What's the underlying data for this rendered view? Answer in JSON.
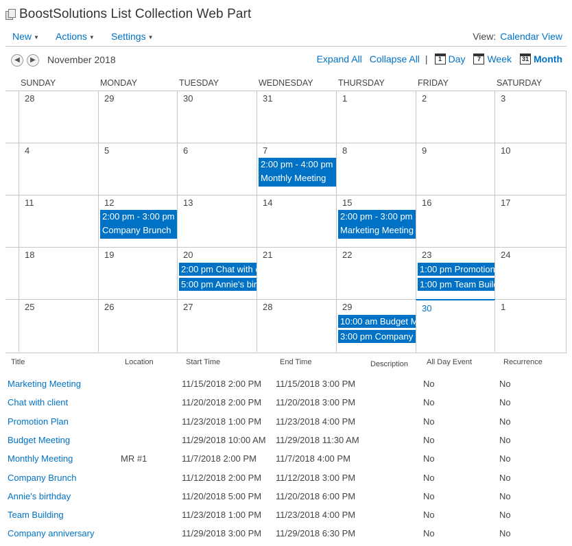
{
  "header": {
    "title": "BoostSolutions List Collection Web Part",
    "icon": "page-icon"
  },
  "menu": {
    "items": [
      {
        "label": "New"
      },
      {
        "label": "Actions"
      },
      {
        "label": "Settings"
      }
    ],
    "view_label": "View:",
    "view_value": "Calendar View"
  },
  "calendar": {
    "month_title": "November 2018",
    "expand_all": "Expand All",
    "collapse_all": "Collapse All",
    "separator": "|",
    "scopes": [
      {
        "label": "Day",
        "icon_text": "1"
      },
      {
        "label": "Week",
        "icon_text": "7"
      },
      {
        "label": "Month",
        "icon_text": "31"
      }
    ],
    "selected_scope": "Month",
    "days_of_week": [
      "SUNDAY",
      "MONDAY",
      "TUESDAY",
      "WEDNESDAY",
      "THURSDAY",
      "FRIDAY",
      "SATURDAY"
    ],
    "weeks": [
      {
        "days": [
          {
            "num": "28",
            "events": []
          },
          {
            "num": "29",
            "events": []
          },
          {
            "num": "30",
            "events": []
          },
          {
            "num": "31",
            "events": []
          },
          {
            "num": "1",
            "events": []
          },
          {
            "num": "2",
            "events": []
          },
          {
            "num": "3",
            "events": []
          }
        ]
      },
      {
        "days": [
          {
            "num": "4",
            "events": []
          },
          {
            "num": "5",
            "events": []
          },
          {
            "num": "6",
            "events": []
          },
          {
            "num": "7",
            "events": [
              {
                "time": "2:00 pm - 4:00 pm",
                "title": "Monthly Meeting"
              }
            ]
          },
          {
            "num": "8",
            "events": []
          },
          {
            "num": "9",
            "events": []
          },
          {
            "num": "10",
            "events": []
          }
        ]
      },
      {
        "days": [
          {
            "num": "11",
            "events": []
          },
          {
            "num": "12",
            "events": [
              {
                "time": "2:00 pm - 3:00 pm",
                "title": "Company Brunch"
              }
            ]
          },
          {
            "num": "13",
            "events": []
          },
          {
            "num": "14",
            "events": []
          },
          {
            "num": "15",
            "events": [
              {
                "time": "2:00 pm - 3:00 pm",
                "title": "Marketing Meeting"
              }
            ]
          },
          {
            "num": "16",
            "events": []
          },
          {
            "num": "17",
            "events": []
          }
        ]
      },
      {
        "days": [
          {
            "num": "18",
            "events": []
          },
          {
            "num": "19",
            "events": []
          },
          {
            "num": "20",
            "events": [
              {
                "text": "2:00 pm Chat with c"
              },
              {
                "text": "5:00 pm Annie's bir"
              }
            ]
          },
          {
            "num": "21",
            "events": []
          },
          {
            "num": "22",
            "events": []
          },
          {
            "num": "23",
            "events": [
              {
                "text": "1:00 pm Promotion"
              },
              {
                "text": "1:00 pm Team Build"
              }
            ]
          },
          {
            "num": "24",
            "events": []
          }
        ]
      },
      {
        "days": [
          {
            "num": "25",
            "events": []
          },
          {
            "num": "26",
            "events": []
          },
          {
            "num": "27",
            "events": []
          },
          {
            "num": "28",
            "events": []
          },
          {
            "num": "29",
            "events": [
              {
                "text": "10:00 am Budget M"
              },
              {
                "text": "3:00 pm Company a"
              }
            ]
          },
          {
            "num": "30",
            "events": [],
            "today": true
          },
          {
            "num": "1",
            "events": []
          }
        ]
      }
    ]
  },
  "list": {
    "columns": [
      "Title",
      "Location",
      "Start Time",
      "End Time",
      "Description",
      "All Day Event",
      "Recurrence"
    ],
    "rows": [
      [
        "Marketing Meeting",
        "",
        "11/15/2018 2:00 PM",
        "11/15/2018 3:00 PM",
        "",
        "No",
        "No"
      ],
      [
        "Chat with client",
        "",
        "11/20/2018 2:00 PM",
        "11/20/2018 3:00 PM",
        "",
        "No",
        "No"
      ],
      [
        "Promotion Plan",
        "",
        "11/23/2018 1:00 PM",
        "11/23/2018 4:00 PM",
        "",
        "No",
        "No"
      ],
      [
        "Budget Meeting",
        "",
        "11/29/2018 10:00 AM",
        "11/29/2018 11:30 AM",
        "",
        "No",
        "No"
      ],
      [
        "Monthly Meeting",
        "MR #1",
        "11/7/2018 2:00 PM",
        "11/7/2018 4:00 PM",
        "",
        "No",
        "No"
      ],
      [
        "Company Brunch",
        "",
        "11/12/2018 2:00 PM",
        "11/12/2018 3:00 PM",
        "",
        "No",
        "No"
      ],
      [
        "Annie's birthday",
        "",
        "11/20/2018 5:00 PM",
        "11/20/2018 6:00 PM",
        "",
        "No",
        "No"
      ],
      [
        "Team Building",
        "",
        "11/23/2018 1:00 PM",
        "11/23/2018 4:00 PM",
        "",
        "No",
        "No"
      ],
      [
        "Company anniversary",
        "",
        "11/29/2018 3:00 PM",
        "11/29/2018 6:30 PM",
        "",
        "No",
        "No"
      ]
    ]
  },
  "colors": {
    "accent": "#0072c6",
    "grid": "#c6c6c6",
    "text": "#444444"
  }
}
